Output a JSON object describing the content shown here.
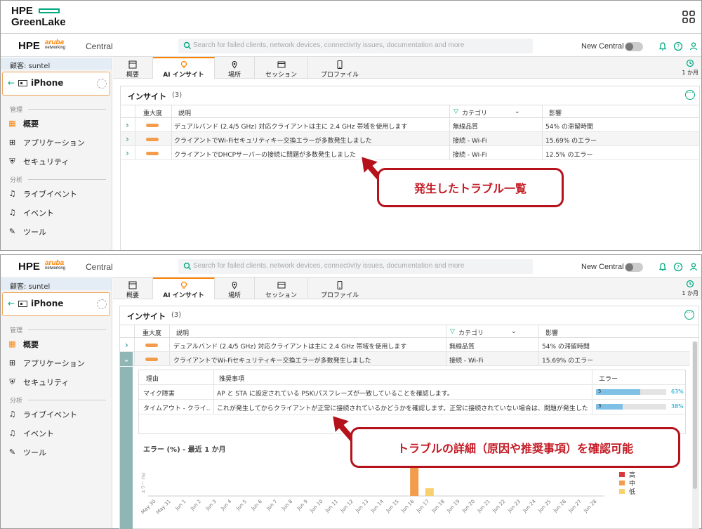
{
  "greenlake": {
    "brand": "HPE",
    "name": "GreenLake"
  },
  "central": {
    "logo_hpe": "HPE",
    "logo_aruba": "aruba",
    "logo_networking": "networking",
    "logo_central": "Central",
    "search_placeholder": "Search for failed clients, network devices, connectivity issues, documentation and more",
    "new_central": "New Central"
  },
  "sidebar": {
    "customer": "顧客: suntel",
    "device": "iPhone",
    "section_manage": "管理",
    "section_analyze": "分析",
    "items": [
      {
        "label": "概要",
        "icon": "grid-icon"
      },
      {
        "label": "アプリケーション",
        "icon": "apps-icon"
      },
      {
        "label": "セキュリティ",
        "icon": "shield-icon"
      },
      {
        "label": "ライブイベント",
        "icon": "bell-icon"
      },
      {
        "label": "イベント",
        "icon": "bell-icon"
      },
      {
        "label": "ツール",
        "icon": "wrench-icon"
      }
    ]
  },
  "tabs": [
    {
      "label": "概要",
      "icon": "overview-icon"
    },
    {
      "label": "AI インサイト",
      "icon": "bulb-icon"
    },
    {
      "label": "場所",
      "icon": "pin-icon"
    },
    {
      "label": "セッション",
      "icon": "window-icon"
    },
    {
      "label": "プロファイル",
      "icon": "phone-icon"
    }
  ],
  "time_range": "1 か月",
  "insights": {
    "title": "インサイト",
    "count": "(3)",
    "columns": {
      "severity": "重大度",
      "description": "説明",
      "category": "カテゴリ",
      "impact": "影響"
    },
    "rows": [
      {
        "description": "デュアルバンド (2.4/5 GHz) 対応クライアントは主に 2.4 GHz 帯域を使用します",
        "category": "無線品質",
        "impact": "54% の滞留時間"
      },
      {
        "description": "クライアントでWi-Fiセキュリティキー交換エラーが多数発生しました",
        "category": "接続 - Wi-Fi",
        "impact": "15.69% のエラー"
      },
      {
        "description": "クライアントでDHCPサーバーの接続に問題が多数発生しました",
        "category": "接続 - Wi-Fi",
        "impact": "12.5% のエラー"
      }
    ]
  },
  "detail": {
    "columns": {
      "reason": "理由",
      "recommendation": "推奨事項",
      "error": "エラー"
    },
    "rows": [
      {
        "reason": "マイク障害",
        "recommendation": "AP と STA に設定されている PSK\\パスフレーズが一致していることを確認します。",
        "count": "5",
        "bar": 0.63,
        "pct": "63%"
      },
      {
        "reason": "タイムアウト - クライ...",
        "recommendation": "これが発生してからクライアントが正常に接続されているかどうかを確認します。正常に接続されていない場合は、問題が発生したクラ...",
        "count": "3",
        "bar": 0.38,
        "pct": "38%"
      }
    ]
  },
  "chart_data": {
    "type": "bar",
    "title": "エラー (%) - 最近 1 か月",
    "ylabel": "エラー (%)",
    "categories": [
      "May 30",
      "May 31",
      "Jun 1",
      "Jun 2",
      "Jun 3",
      "Jun 4",
      "Jun 5",
      "Jun 6",
      "Jun 7",
      "Jun 8",
      "Jun 9",
      "Jun 10",
      "Jun 11",
      "Jun 12",
      "Jun 13",
      "Jun 14",
      "Jun 15",
      "Jun 16",
      "Jun 17",
      "Jun 18",
      "Jun 19",
      "Jun 20",
      "Jun 21",
      "Jun 22",
      "Jun 23",
      "Jun 24",
      "Jun 25",
      "Jun 26",
      "Jun 27",
      "Jun 28"
    ],
    "series": [
      {
        "name": "高",
        "color": "#d9383a",
        "values": [
          0,
          0,
          0,
          0,
          0,
          0,
          0,
          0,
          0,
          0,
          0,
          0,
          0,
          0,
          0,
          0,
          0,
          0,
          0,
          0,
          0,
          0,
          0,
          0,
          0,
          0,
          0,
          0,
          0,
          0
        ]
      },
      {
        "name": "中",
        "color": "#f29c4c",
        "values": [
          0,
          0,
          0,
          0,
          0,
          0,
          0,
          0,
          0,
          0,
          0,
          0,
          0,
          0,
          0,
          0,
          0,
          1.0,
          0,
          0,
          0,
          0,
          0,
          0,
          0,
          0,
          0,
          0,
          0,
          0
        ]
      },
      {
        "name": "低",
        "color": "#f7d170",
        "values": [
          0,
          0,
          0,
          0,
          0,
          0,
          0,
          0,
          0,
          0,
          0,
          0,
          0,
          0,
          0,
          0,
          0,
          0,
          0.25,
          0,
          0,
          0,
          0,
          0,
          0,
          0,
          0,
          0,
          0,
          0
        ]
      }
    ]
  },
  "callouts": {
    "top": "発生したトラブル一覧",
    "bottom": "トラブルの詳細（原因や推奨事項）を確認可能"
  }
}
